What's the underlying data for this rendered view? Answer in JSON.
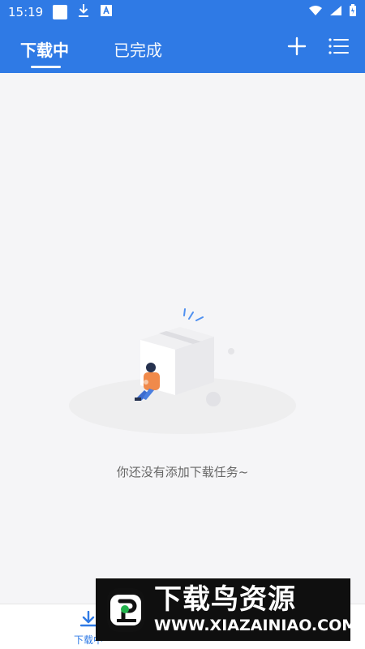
{
  "status_bar": {
    "time": "15:19",
    "icons_left": [
      "notification-square-icon",
      "download-icon",
      "app-a-icon"
    ],
    "icons_right": [
      "wifi-icon",
      "signal-icon",
      "battery-icon"
    ]
  },
  "header": {
    "tabs": [
      {
        "label": "下载中",
        "active": true
      },
      {
        "label": "已完成",
        "active": false
      }
    ],
    "actions": [
      "plus-icon",
      "menu-list-icon"
    ],
    "color": "#2f7ae5"
  },
  "empty_state": {
    "message": "你还没有添加下载任务~"
  },
  "bottom_nav": {
    "items": [
      {
        "label": "下载中",
        "icon": "download-arrow-icon",
        "active": true
      }
    ]
  },
  "watermark": {
    "title": "下载鸟资源",
    "url": "WWW.XIAZAINIAO.COM"
  }
}
